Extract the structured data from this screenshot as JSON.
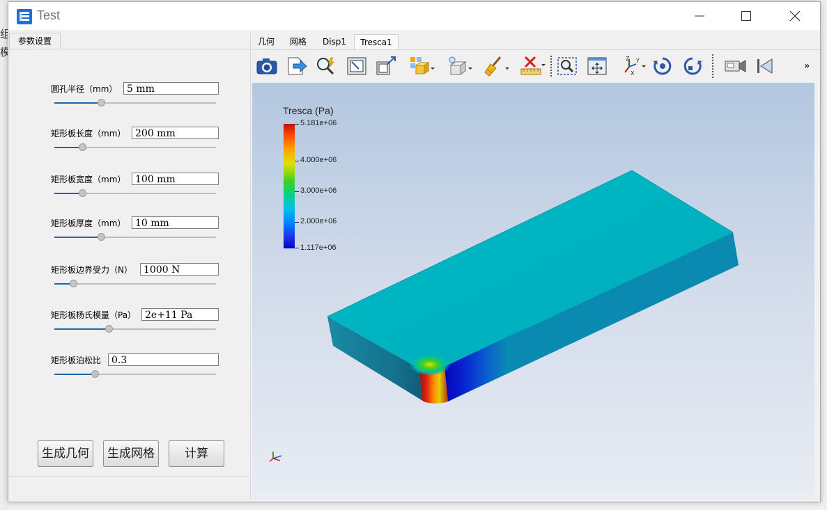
{
  "window": {
    "title": "Test",
    "icon": "app-stack-icon",
    "controls": [
      "minimize-icon",
      "maximize-icon",
      "close-icon"
    ]
  },
  "background_fragments": [
    "组",
    "模"
  ],
  "left_panel": {
    "tab": "参数设置",
    "params": [
      {
        "label": "圆孔半径（mm）",
        "value": "5 mm",
        "slider_fraction": 0.28
      },
      {
        "label": "矩形板长度（mm）",
        "value": "200 mm",
        "slider_fraction": 0.16
      },
      {
        "label": "矩形板宽度（mm）",
        "value": "100 mm",
        "slider_fraction": 0.16
      },
      {
        "label": "矩形板厚度（mm）",
        "value": "10 mm",
        "slider_fraction": 0.28
      },
      {
        "label": "矩形板边界受力（N）",
        "value": "1000 N",
        "slider_fraction": 0.1
      },
      {
        "label": "矩形板杨氏模量（Pa）",
        "value": "2e+11 Pa",
        "slider_fraction": 0.33
      },
      {
        "label": "矩形板泊松比",
        "value": "0.3",
        "slider_fraction": 0.24
      }
    ],
    "buttons": {
      "geometry": "生成几何",
      "mesh": "生成网格",
      "compute": "计算"
    }
  },
  "view_tabs": [
    {
      "label": "几何",
      "active": false
    },
    {
      "label": "网格",
      "active": false
    },
    {
      "label": "Disp1",
      "active": false
    },
    {
      "label": "Tresca1",
      "active": true
    }
  ],
  "toolbar": {
    "icons": [
      "camera-icon",
      "export-arrow-icon",
      "magnify-pick-icon",
      "frame-inset-icon",
      "frame-expand-icon",
      "display-mode-icon",
      "render-style-icon",
      "clear-brush-icon",
      "measure-ruler-icon",
      "zoom-box-icon",
      "fit-all-icon",
      "axes-xyz-icon",
      "rotate-cw-icon",
      "rotate-ccw-icon",
      "video-camera-icon",
      "reset-view-icon"
    ],
    "overflow": "»"
  },
  "legend": {
    "title": "Tresca (Pa)",
    "max_label": "5.181e+06",
    "ticks": [
      "4.000e+06",
      "3.000e+06",
      "2.000e+06"
    ],
    "min_label": "1.117e+06",
    "max_value": 5181000,
    "min_value": 1117000,
    "tick_values": [
      4000000,
      3000000,
      2000000
    ]
  },
  "colors": {
    "plate_top": "#00b2c2",
    "plate_side": "#008fa6",
    "plate_front": "#0d7d96",
    "stress_high": "#e02010",
    "stress_low": "#0505b8",
    "slider_fill": "#2563a8"
  }
}
